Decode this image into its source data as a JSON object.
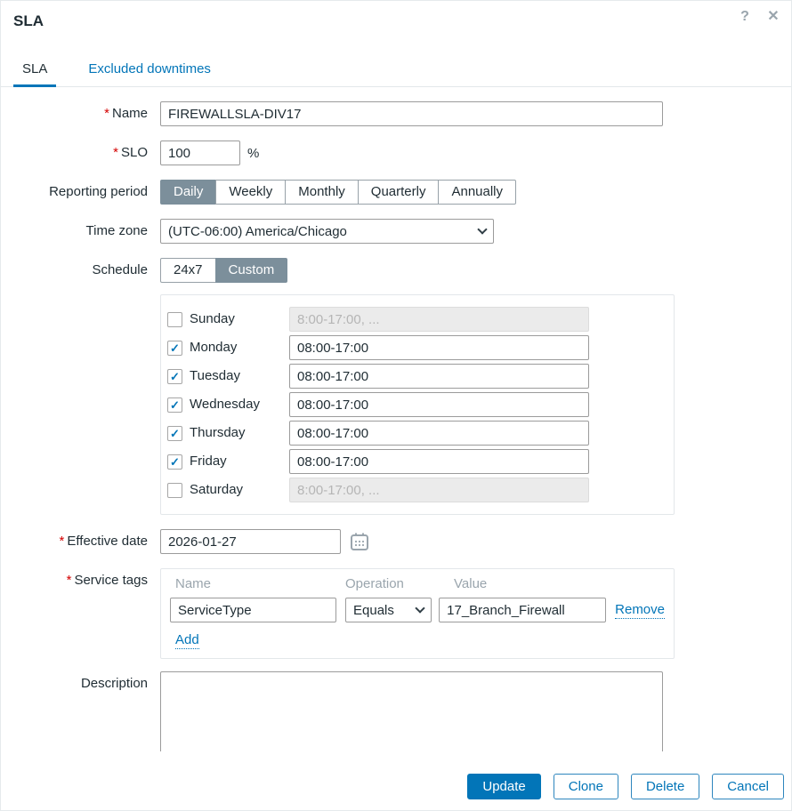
{
  "window": {
    "title": "SLA"
  },
  "icons": {
    "help": "?",
    "close": "✕",
    "check": "✓",
    "chevron": "chevron-down",
    "calendar": "calendar"
  },
  "required_mark": "*",
  "tabs": {
    "sla": "SLA",
    "excluded_downtimes": "Excluded downtimes"
  },
  "form": {
    "name": {
      "label": "Name",
      "value": "FIREWALLSLA-DIV17"
    },
    "slo": {
      "label": "SLO",
      "value": "100",
      "suffix": "%"
    },
    "reporting_period": {
      "label": "Reporting period",
      "options": [
        "Daily",
        "Weekly",
        "Monthly",
        "Quarterly",
        "Annually"
      ],
      "selected": "Daily"
    },
    "time_zone": {
      "label": "Time zone",
      "value": "(UTC-06:00) America/Chicago"
    },
    "schedule": {
      "label": "Schedule",
      "options": [
        "24x7",
        "Custom"
      ],
      "selected": "Custom"
    },
    "schedule_days": [
      {
        "day": "Sunday",
        "checked": false,
        "value": "",
        "placeholder": "8:00-17:00, ..."
      },
      {
        "day": "Monday",
        "checked": true,
        "value": "08:00-17:00"
      },
      {
        "day": "Tuesday",
        "checked": true,
        "value": "08:00-17:00"
      },
      {
        "day": "Wednesday",
        "checked": true,
        "value": "08:00-17:00"
      },
      {
        "day": "Thursday",
        "checked": true,
        "value": "08:00-17:00"
      },
      {
        "day": "Friday",
        "checked": true,
        "value": "08:00-17:00"
      },
      {
        "day": "Saturday",
        "checked": false,
        "value": "",
        "placeholder": "8:00-17:00, ..."
      }
    ],
    "effective_date": {
      "label": "Effective date",
      "value": "2026-01-27"
    },
    "service_tags": {
      "label": "Service tags",
      "headers": {
        "name": "Name",
        "operation": "Operation",
        "value": "Value"
      },
      "rows": [
        {
          "name": "ServiceType",
          "operation": "Equals",
          "value": "17_Branch_Firewall",
          "remove_label": "Remove"
        }
      ],
      "add_label": "Add"
    },
    "description": {
      "label": "Description",
      "value": ""
    }
  },
  "footer": {
    "update": "Update",
    "clone": "Clone",
    "delete": "Delete",
    "cancel": "Cancel"
  },
  "colors": {
    "accent": "#0275b8",
    "selected_segment": "#7c8f9b",
    "required_mark": "#d40000",
    "disabled_input_bg": "#ebebeb"
  }
}
